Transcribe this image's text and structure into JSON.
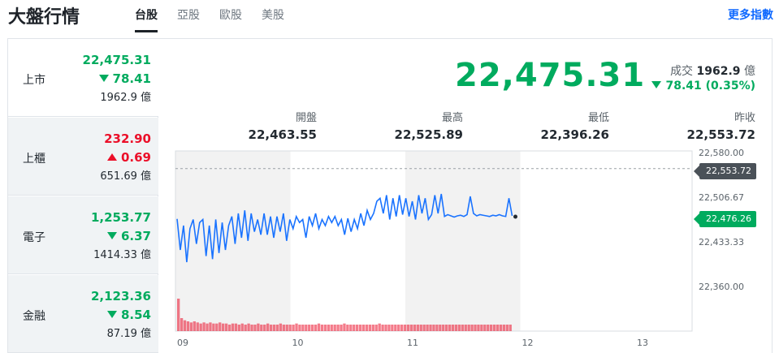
{
  "header": {
    "title": "大盤行情",
    "tabs": [
      "台股",
      "亞股",
      "歐股",
      "美股"
    ],
    "more_link": "更多指數"
  },
  "markets": [
    {
      "name": "上市",
      "price": "22,475.31",
      "change": "78.41",
      "direction": "down",
      "volume": "1962.9 億"
    },
    {
      "name": "上櫃",
      "price": "232.90",
      "change": "0.69",
      "direction": "up",
      "volume": "651.69 億"
    },
    {
      "name": "電子",
      "price": "1,253.77",
      "change": "6.37",
      "direction": "down",
      "volume": "1414.33 億"
    },
    {
      "name": "金融",
      "price": "2,123.36",
      "change": "8.54",
      "direction": "down",
      "volume": "87.19 億"
    }
  ],
  "detail": {
    "price": "22,475.31",
    "volume_label": "成交",
    "volume_value": "1962.9",
    "volume_unit": "億",
    "change": "78.41 (0.35%)",
    "stats": [
      {
        "label": "開盤",
        "value": "22,463.55"
      },
      {
        "label": "最高",
        "value": "22,525.89"
      },
      {
        "label": "最低",
        "value": "22,396.26"
      },
      {
        "label": "昨收",
        "value": "22,553.72"
      }
    ]
  },
  "colors": {
    "up": "#eb0f29",
    "down": "#00ab5e",
    "line": "#1a73ff",
    "volume": "#eb0f29",
    "link": "#0f69ff"
  },
  "chart_data": {
    "type": "line",
    "x_ticks": [
      "09",
      "10",
      "11",
      "12",
      "13"
    ],
    "y_ticks": [
      "22,580.00",
      "22,506.67",
      "22,433.33",
      "22,360.00"
    ],
    "ylim": [
      22360,
      22580
    ],
    "prev_close": 22553.72,
    "prev_close_label": "22,553.72",
    "current_label": "22,476.26",
    "current": 22476.26,
    "series_values": [
      22471,
      22420,
      22460,
      22400,
      22455,
      22470,
      22430,
      22465,
      22470,
      22410,
      22460,
      22405,
      22470,
      22415,
      22465,
      22420,
      22460,
      22475,
      22430,
      22480,
      22440,
      22485,
      22435,
      22480,
      22450,
      22470,
      22445,
      22480,
      22445,
      22475,
      22440,
      22475,
      22450,
      22480,
      22435,
      22470,
      22455,
      22475,
      22465,
      22470,
      22440,
      22475,
      22460,
      22480,
      22455,
      22470,
      22460,
      22475,
      22465,
      22475,
      22460,
      22470,
      22445,
      22472,
      22450,
      22470,
      22455,
      22480,
      22460,
      22485,
      22470,
      22480,
      22500,
      22505,
      22480,
      22510,
      22470,
      22505,
      22475,
      22510,
      22478,
      22505,
      22475,
      22500,
      22470,
      22510,
      22480,
      22505,
      22470,
      22478,
      22510,
      22480,
      22512,
      22475,
      22478,
      22476,
      22474,
      22476,
      22477,
      22475,
      22478,
      22508,
      22480,
      22476,
      22478,
      22477,
      22476,
      22475,
      22477,
      22476,
      22478,
      22476,
      22475,
      22505,
      22476
    ],
    "volume_values": [
      30,
      12,
      10,
      9,
      8,
      9,
      8,
      7,
      8,
      7,
      8,
      7,
      7,
      8,
      7,
      7,
      6,
      7,
      7,
      6,
      7,
      6,
      7,
      6,
      6,
      7,
      6,
      6,
      7,
      6,
      6,
      6,
      7,
      6,
      6,
      6,
      6,
      7,
      6,
      6,
      6,
      6,
      6,
      6,
      7,
      6,
      6,
      6,
      6,
      6,
      6,
      6,
      7,
      6,
      6,
      6,
      6,
      6,
      6,
      6,
      6,
      6,
      6,
      7,
      6,
      6,
      6,
      6,
      6,
      6,
      6,
      6,
      6,
      6,
      6,
      6,
      6,
      6,
      6,
      6,
      6,
      6,
      6,
      6,
      6,
      6,
      6,
      6,
      6,
      6,
      6,
      6,
      6,
      6,
      6,
      6,
      6,
      6,
      6,
      6,
      6,
      6,
      6,
      6,
      6
    ]
  }
}
